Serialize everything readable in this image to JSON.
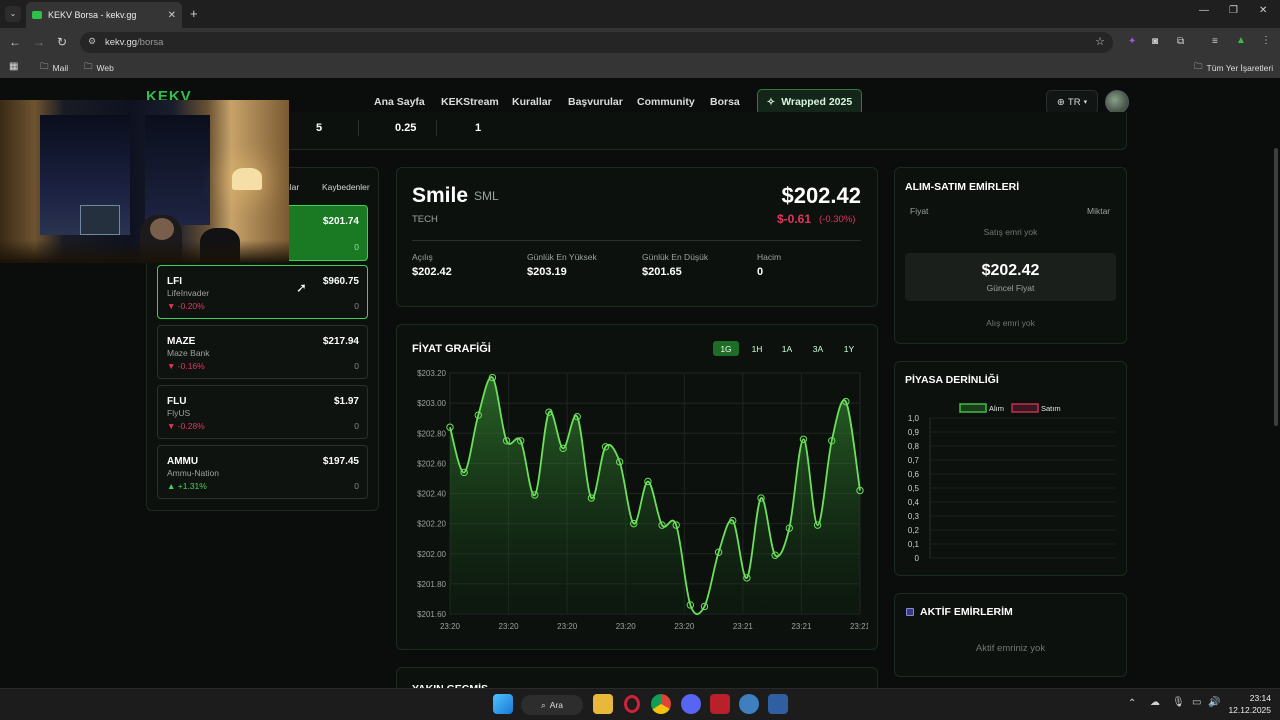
{
  "browser": {
    "tab_title": "KEKV Borsa - kekv.gg",
    "url_host": "kekv.gg",
    "url_path": "/borsa",
    "bookmarks": [
      "Mail",
      "Web"
    ],
    "all_bookmarks": "Tüm Yer İşaretleri"
  },
  "nav": {
    "logo": "KEKV",
    "links": [
      "Ana Sayfa",
      "KEKStream",
      "Kurallar",
      "Başvurular",
      "Community",
      "Borsa"
    ],
    "wrapped": "Wrapped 2025",
    "lang": "TR"
  },
  "stats": [
    "5",
    "0.25",
    "1"
  ],
  "list": {
    "tabs": [
      "nlar",
      "Kaybedenler"
    ],
    "selected_price": "$201.74",
    "selected_volume": "0",
    "items": [
      {
        "sym": "LFI",
        "name": "LifeInvader",
        "price": "$960.75",
        "change": "▼ -0.20%",
        "vol": "0",
        "dir": "neg"
      },
      {
        "sym": "MAZE",
        "name": "Maze Bank",
        "price": "$217.94",
        "change": "▼ -0.16%",
        "vol": "0",
        "dir": "neg"
      },
      {
        "sym": "FLU",
        "name": "FlyUS",
        "price": "$1.97",
        "change": "▼ -0.28%",
        "vol": "0",
        "dir": "neg"
      },
      {
        "sym": "AMMU",
        "name": "Ammu-Nation",
        "price": "$197.45",
        "change": "▲ +1.31%",
        "vol": "0",
        "dir": "pos"
      }
    ]
  },
  "detail": {
    "name": "Smile",
    "sym": "SML",
    "sector": "TECH",
    "price": "$202.42",
    "change": "$-0.61",
    "change_pct": "(-0.30%)",
    "labels": [
      "Açılış",
      "Günlük En Yüksek",
      "Günlük En Düşük",
      "Hacim"
    ],
    "values": [
      "$202.42",
      "$203.19",
      "$201.65",
      "0"
    ]
  },
  "chart_panel": {
    "title": "FİYAT GRAFİĞİ",
    "timeframes": [
      "1G",
      "1H",
      "1A",
      "3A",
      "1Y"
    ],
    "active_timeframe": "1G"
  },
  "chart_data": {
    "type": "area",
    "x_ticks": [
      "23:20",
      "23:20",
      "23:20",
      "23:20",
      "23:20",
      "23:21",
      "23:21",
      "23:21"
    ],
    "y_ticks": [
      "$203.20",
      "$203.00",
      "$202.80",
      "$202.60",
      "$202.40",
      "$202.20",
      "$202.00",
      "$201.80",
      "$201.60"
    ],
    "ylim": [
      201.6,
      203.2
    ],
    "values": [
      202.84,
      202.54,
      202.92,
      203.17,
      202.75,
      202.75,
      202.39,
      202.94,
      202.7,
      202.91,
      202.37,
      202.71,
      202.61,
      202.2,
      202.48,
      202.19,
      202.19,
      201.66,
      201.65,
      202.01,
      202.22,
      201.84,
      202.37,
      201.99,
      202.17,
      202.76,
      202.19,
      202.75,
      203.01,
      202.42
    ],
    "color": "#6be05a"
  },
  "orders": {
    "title": "ALIM-SATIM EMİRLERİ",
    "col_price": "Fiyat",
    "col_qty": "Miktar",
    "sell_empty": "Satış emri yok",
    "current_price": "$202.42",
    "current_label": "Güncel Fiyat",
    "buy_empty": "Alış emri yok"
  },
  "depth": {
    "title": "PİYASA DERİNLİĞİ",
    "legend_buy": "Alım",
    "legend_sell": "Satım",
    "y_ticks": [
      "1,0",
      "0,9",
      "0,8",
      "0,7",
      "0,6",
      "0,5",
      "0,4",
      "0,3",
      "0,2",
      "0,1",
      "0"
    ],
    "buy_color": "#3fbf3f",
    "sell_color": "#c0304d"
  },
  "active_orders": {
    "title": "AKTİF EMİRLERİM",
    "empty": "Aktif emriniz yok"
  },
  "below_title": "YAKIN GEÇMİŞ",
  "taskbar": {
    "search": "Ara",
    "time": "23:14",
    "date": "12.12.2025"
  }
}
